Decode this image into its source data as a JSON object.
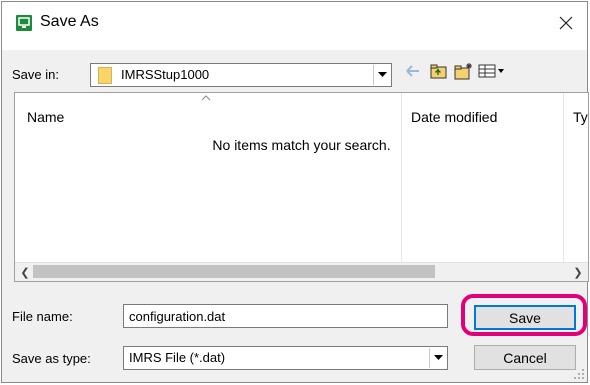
{
  "window": {
    "title": "Save As",
    "app_icon": "save-icon",
    "close_glyph": "✕"
  },
  "save_in": {
    "label": "Save in:",
    "value": "IMRSStup1000",
    "toolbar_icons": [
      "back-arrow-icon",
      "up-folder-icon",
      "new-folder-icon",
      "view-menu-icon"
    ]
  },
  "file_list": {
    "columns": [
      "Name",
      "Date modified",
      "Ty"
    ],
    "empty_message": "No items match your search."
  },
  "file_name": {
    "label": "File name:",
    "value": "configuration.dat"
  },
  "save_as_type": {
    "label": "Save as type:",
    "value": "IMRS File (*.dat)"
  },
  "buttons": {
    "save": "Save",
    "cancel": "Cancel"
  },
  "colors": {
    "highlight": "#e2007a",
    "app_icon": "#1e8a3c",
    "default_button_border": "#0078d7"
  }
}
